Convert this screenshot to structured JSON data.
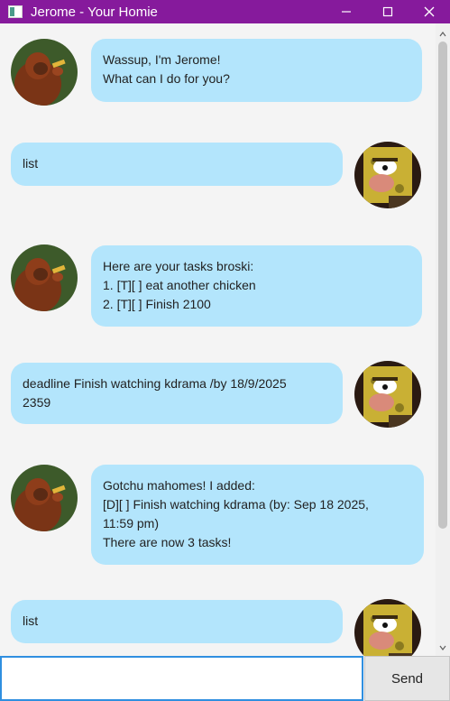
{
  "window": {
    "title": "Jerome - Your Homie",
    "app_icon": "window-app-icon",
    "controls": [
      "minimize-icon",
      "maximize-icon",
      "close-icon"
    ]
  },
  "colors": {
    "titlebar": "#861a9c",
    "bubble": "#b3e5fc",
    "background": "#f4f4f4",
    "input_border": "#2f8fe0"
  },
  "messages": [
    {
      "sender": "bot",
      "avatar": "orangutan-avatar",
      "lines": [
        "Wassup, I'm Jerome!",
        "What can I do for you?"
      ]
    },
    {
      "sender": "user",
      "avatar": "spongegar-avatar",
      "lines": [
        "list"
      ]
    },
    {
      "sender": "bot",
      "avatar": "orangutan-avatar",
      "lines": [
        "Here are your tasks broski:",
        "1. [T][ ] eat another chicken",
        "2. [T][ ] Finish 2100"
      ]
    },
    {
      "sender": "user",
      "avatar": "spongegar-avatar",
      "lines": [
        "deadline Finish watching kdrama /by 18/9/2025",
        "2359"
      ]
    },
    {
      "sender": "bot",
      "avatar": "orangutan-avatar",
      "lines": [
        "Gotchu mahomes! I added:",
        "[D][ ] Finish watching kdrama (by: Sep 18 2025,",
        "11:59 pm)",
        "There are now 3 tasks!"
      ]
    },
    {
      "sender": "user",
      "avatar": "spongegar-avatar",
      "lines": [
        "list"
      ]
    }
  ],
  "input": {
    "value": "",
    "placeholder": ""
  },
  "send_button": {
    "label": "Send"
  }
}
